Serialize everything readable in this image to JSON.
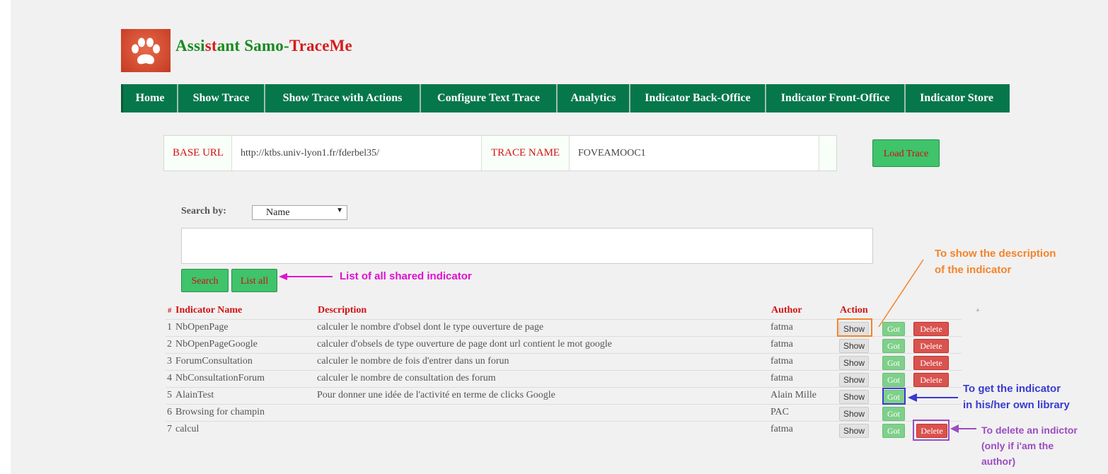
{
  "app": {
    "title_part1": "Assi",
    "title_part2": "st",
    "title_part3": "ant ",
    "title_part4": "Samo-",
    "title_part5": "TraceMe"
  },
  "nav": [
    "Home",
    "Show Trace",
    "Show Trace with Actions",
    "Configure Text Trace",
    "Analytics",
    "Indicator Back-Office",
    "Indicator Front-Office",
    "Indicator Store"
  ],
  "trace": {
    "base_url_label": "BASE URL",
    "base_url_value": "http://ktbs.univ-lyon1.fr/fderbel35/",
    "trace_name_label": "TRACE NAME",
    "trace_name_value": "FOVEAMOOC1",
    "load_button": "Load Trace"
  },
  "search": {
    "label": "Search by:",
    "selected": "Name",
    "search_button": "Search",
    "list_all_button": "List all"
  },
  "table": {
    "headers": {
      "num": "#",
      "name": "Indicator Name",
      "description": "Description",
      "author": "Author",
      "action": "Action"
    },
    "rows": [
      {
        "num": "1",
        "name": "NbOpenPage",
        "description": "calculer le nombre d'obsel dont le type ouverture de page",
        "author": "fatma",
        "show": "Show",
        "got": "Got",
        "delete": "Delete"
      },
      {
        "num": "2",
        "name": "NbOpenPageGoogle",
        "description": "calculer d'obsels de type ouverture de page dont url contient le mot google",
        "author": "fatma",
        "show": "Show",
        "got": "Got",
        "delete": "Delete"
      },
      {
        "num": "3",
        "name": "ForumConsultation",
        "description": "calculer le nombre de fois d'entrer dans un forun",
        "author": "fatma",
        "show": "Show",
        "got": "Got",
        "delete": "Delete"
      },
      {
        "num": "4",
        "name": "NbConsultationForum",
        "description": "calculer le nombre de consultation des forum",
        "author": "fatma",
        "show": "Show",
        "got": "Got",
        "delete": "Delete"
      },
      {
        "num": "5",
        "name": "AlainTest",
        "description": "Pour donner une idée de l'activité en terme de clicks Google",
        "author": "Alain Mille",
        "show": "Show",
        "got": "Got",
        "delete": ""
      },
      {
        "num": "6",
        "name": "Browsing for champin",
        "description": "",
        "author": "PAC",
        "show": "Show",
        "got": "Got",
        "delete": ""
      },
      {
        "num": "7",
        "name": "calcul",
        "description": "",
        "author": "fatma",
        "show": "Show",
        "got": "Got",
        "delete": "Delete"
      }
    ]
  },
  "annotations": {
    "list_all": "List of all shared indicator",
    "show_1": "To show the description",
    "show_2": "of the indicator",
    "got_1": "To get the indicator",
    "got_2": "in his/her own library",
    "del_1": "To delete an indictor",
    "del_2": "(only if i'am the",
    "del_3": "author)"
  },
  "colors": {
    "nav_bg": "#06774a",
    "label_red": "#d41111",
    "btn_green": "#3fc36b",
    "note_magenta": "#e010d0",
    "note_orange": "#f5832a",
    "note_blue": "#3a3ad0",
    "note_purple": "#9b4cc0"
  }
}
